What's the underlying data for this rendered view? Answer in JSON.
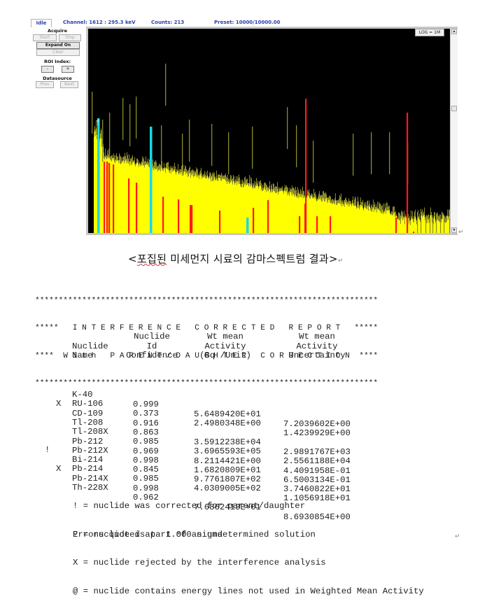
{
  "status_bar": {
    "state": "Idle",
    "channel_label": "Channel:",
    "channel_value": "1612  :  295.3 keV",
    "counts_label": "Counts:",
    "counts_value": "213",
    "preset_label": "Preset:",
    "preset_value": "10000/10000.00"
  },
  "control_panel": {
    "acquire_header": "Acquire",
    "start_label": "Start",
    "stop_label": "Stop",
    "expand_label": "Expand On",
    "clear_label": "Clear",
    "roi_header": "ROI Index:",
    "roi_minus": "-",
    "roi_plus": "+",
    "datasource_header": "Datasource",
    "prev_label": "Prev",
    "next_label": "Next"
  },
  "spectrum": {
    "scale_label": "LOG = 1M",
    "colors": {
      "background": "#000000",
      "counts": "#ffff00",
      "roi_red": "#ff1a1a",
      "roi_cyan": "#19d9e6",
      "peak_outline": "#8a8a2a"
    },
    "scroll_up_icon": "▲",
    "scroll_down_icon": "▼"
  },
  "caption": {
    "open": "<",
    "underlined": "포집된",
    "rest": " 미세먼지 시료의 감마스펙트럼 결과>"
  },
  "report": {
    "banner": [
      "*************************************************************************",
      "*****   I N T E R F E R E N C E   C O R R E C T E D   R E P O R T   *****",
      "****  W i t h   P A R E N T / D A U G H T E R   C O R R E C T I O N  ****",
      "*************************************************************************"
    ],
    "headers": {
      "name": [
        "",
        "Nuclide",
        "Name"
      ],
      "confidence": [
        "Nuclide",
        "Id",
        "Confidence"
      ],
      "activity": [
        "Wt mean",
        "Activity",
        "(Bq /Unit)"
      ],
      "uncertainty": [
        "Wt mean",
        "Activity",
        "Uncertainty"
      ]
    },
    "rows": [
      {
        "flag": "",
        "name": "K-40",
        "confidence": "0.999",
        "activity": "5.6489420E+01",
        "uncertainty": "7.2039602E+00"
      },
      {
        "flag": "",
        "name": "RU-106",
        "confidence": "0.373",
        "activity": "2.4980348E+00",
        "uncertainty": "1.4239929E+00"
      },
      {
        "flag": "X",
        "name": "CD-109",
        "confidence": "0.916",
        "activity": "",
        "uncertainty": ""
      },
      {
        "flag": "",
        "name": "Tl-208",
        "confidence": "0.863",
        "activity": "3.5912238E+04",
        "uncertainty": "2.9891767E+03"
      },
      {
        "flag": "",
        "name": "Tl-208X",
        "confidence": "0.985",
        "activity": "3.6965593E+05",
        "uncertainty": "2.5561188E+04"
      },
      {
        "flag": "",
        "name": "Pb-212",
        "confidence": "0.969",
        "activity": "8.2114421E+00",
        "uncertainty": "4.4091958E-01"
      },
      {
        "flag": "",
        "name": "Pb-212X",
        "confidence": "0.998",
        "activity": "1.6820809E+01",
        "uncertainty": "6.5003134E-01"
      },
      {
        "flag": "!",
        "name": "Bi-214",
        "confidence": "0.845",
        "activity": "9.7761807E+02",
        "uncertainty": "3.7460822E+01"
      },
      {
        "flag": "",
        "name": "Pb-214",
        "confidence": "0.985",
        "activity": "4.0309005E+02",
        "uncertainty": "1.1056918E+01"
      },
      {
        "flag": "X",
        "name": "Pb-214X",
        "confidence": "0.998",
        "activity": "",
        "uncertainty": ""
      },
      {
        "flag": "",
        "name": "Th-228X",
        "confidence": "0.962",
        "activity": "7.6862413E+01",
        "uncertainty": "8.6930854E+00"
      }
    ],
    "legend": [
      "! = nuclide was corrected for parent/daughter",
      "? = nuclide is part of an undetermined solution",
      "X = nuclide rejected by the interference analysis",
      "@ = nuclide contains energy lines not used in Weighted Mean Activity"
    ],
    "errors_line": "Errors quoted at  1.000 sigma"
  },
  "paragraph_mark": "↵"
}
